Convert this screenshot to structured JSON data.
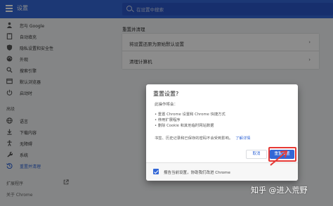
{
  "header": {
    "title": "设置",
    "search_placeholder": "在设置中搜索"
  },
  "sidebar": {
    "items": [
      {
        "label": "您与 Google",
        "icon": "person-icon"
      },
      {
        "label": "自动填充",
        "icon": "clipboard-icon"
      },
      {
        "label": "隐私设置和安全性",
        "icon": "shield-icon"
      },
      {
        "label": "外观",
        "icon": "palette-icon"
      },
      {
        "label": "搜索引擎",
        "icon": "search-icon"
      },
      {
        "label": "默认浏览器",
        "icon": "browser-icon"
      },
      {
        "label": "启动时",
        "icon": "power-icon"
      }
    ],
    "advanced_label": "高级",
    "advanced_items": [
      {
        "label": "语言",
        "icon": "globe-icon"
      },
      {
        "label": "下载内容",
        "icon": "download-icon"
      },
      {
        "label": "无障碍",
        "icon": "accessibility-icon"
      },
      {
        "label": "系统",
        "icon": "wrench-icon"
      },
      {
        "label": "重置并清理",
        "icon": "history-icon"
      }
    ],
    "extensions_label": "扩展程序",
    "about_label": "关于 Chrome"
  },
  "main": {
    "section_title": "重置并清理",
    "rows": [
      {
        "label": "将设置还原为原始默认设置"
      },
      {
        "label": "清理计算机"
      }
    ]
  },
  "dialog": {
    "title": "重置设置?",
    "intro": "此操作将会：",
    "bullets": [
      "• 重置 Chrome 设置和 Chrome 快捷方式",
      "• 停用扩展程序",
      "• 删除 Cookie 和其他临时网站数据"
    ],
    "note": "书签、历史记录和已保存的密码不会受到影响。",
    "learn_more": "了解详情",
    "cancel_label": "取消",
    "reset_label": "重置设置",
    "footer_text": "报告当前设置，协助我们改进 Chrome",
    "report_checked": true
  },
  "watermark": "知乎 @进入荒野",
  "colors": {
    "accent": "#3367d6",
    "highlight": "#e53935"
  }
}
